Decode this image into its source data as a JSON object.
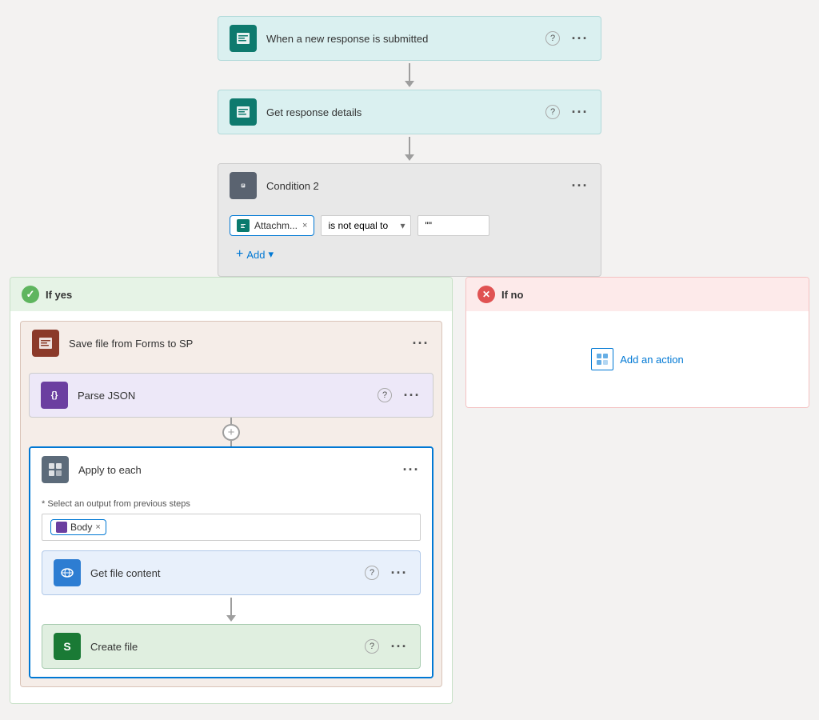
{
  "steps": {
    "step1": {
      "label": "When a new response is submitted",
      "iconColor": "#0e7a6e"
    },
    "step2": {
      "label": "Get response details",
      "iconColor": "#0e7a6e"
    },
    "condition": {
      "label": "Condition 2",
      "iconColor": "#4a5568",
      "token": "Attachm...",
      "operator": "is not equal to",
      "value": "\"\""
    }
  },
  "branches": {
    "ifYes": {
      "label": "If yes",
      "scope": {
        "label": "Save file from Forms to SP"
      },
      "parseJson": {
        "label": "Parse JSON"
      },
      "applyToEach": {
        "label": "Apply to each",
        "selectLabel": "* Select an output from previous steps",
        "bodyToken": "Body"
      },
      "getFileContent": {
        "label": "Get file content"
      },
      "createFile": {
        "label": "Create file"
      }
    },
    "ifNo": {
      "label": "If no",
      "addAction": "Add an action"
    }
  },
  "icons": {
    "question": "?",
    "more": "···",
    "check": "✓",
    "cross": "✕",
    "plus": "+",
    "chevronDown": "▾",
    "formsIcon": "≡",
    "conditionIcon": "⊞",
    "parseJsonGlyph": "{ }",
    "applyEachGlyph": "⊡",
    "cloudGlyph": "☁",
    "fileGlyph": "📄",
    "removeX": "×",
    "addActionGlyph": "⊡"
  }
}
